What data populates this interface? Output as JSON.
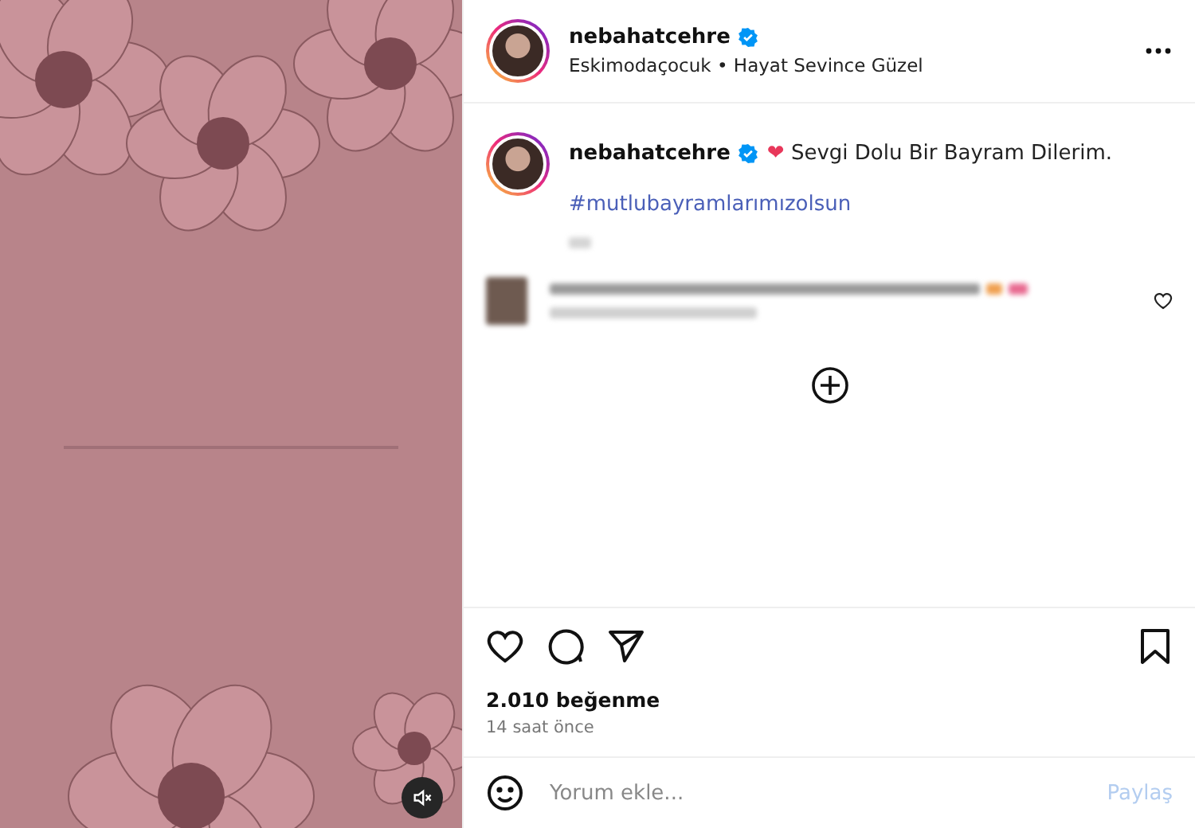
{
  "media": {
    "muted": true
  },
  "header": {
    "username": "nebahatcehre",
    "verified": true,
    "subtitle": "Eskimodaçocuk • Hayat Sevince Güzel"
  },
  "caption": {
    "username": "nebahatcehre",
    "verified": true,
    "emoji": "❤",
    "text": "Sevgi Dolu Bir Bayram Dilerim.",
    "hashtag": "#mutlubayramlarımızolsun"
  },
  "likes": "2.010 beğenme",
  "time": "14 saat önce",
  "comment_field": {
    "placeholder": "Yorum ekle..."
  },
  "post_button": {
    "label": "Paylaş",
    "disabled": true
  }
}
